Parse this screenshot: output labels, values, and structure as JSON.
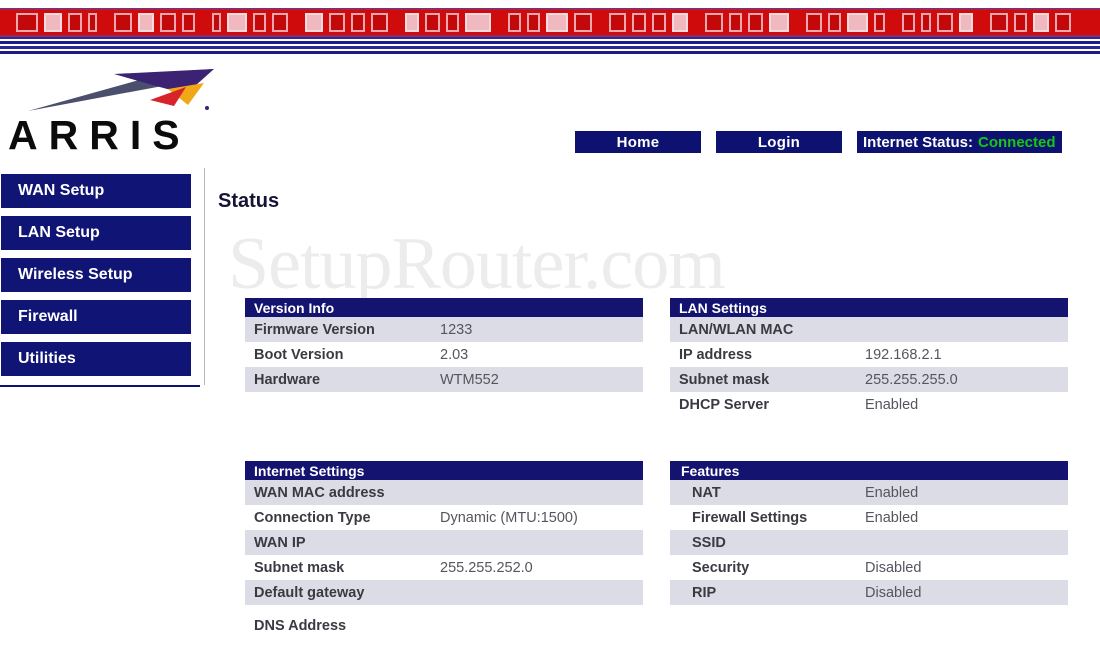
{
  "banner": {
    "name": "decorative-top-banner",
    "red": "#d00b0b",
    "accent_pale": "#f0b9c0",
    "line_navy": "#1b1b8c"
  },
  "brand": {
    "wordmark": "ARRIS",
    "swoosh_purple": "#3b2273",
    "swoosh_orange": "#f0a818",
    "swoosh_red": "#d8232a"
  },
  "topnav": {
    "buttons": [
      {
        "label": "Home",
        "name": "home-button"
      },
      {
        "label": "Login",
        "name": "login-button"
      }
    ],
    "status_label": "Internet Status:",
    "status_value": "Connected",
    "status_color": "#14c814"
  },
  "sidebar": {
    "items": [
      {
        "label": "WAN Setup"
      },
      {
        "label": "LAN Setup"
      },
      {
        "label": "Wireless Setup"
      },
      {
        "label": "Firewall"
      },
      {
        "label": "Utilities"
      }
    ]
  },
  "main": {
    "title": "Status",
    "watermark": "SetupRouter.com"
  },
  "panels": {
    "version_info": {
      "title": "Version Info",
      "rows": [
        {
          "key": "Firmware Version",
          "value": "1233"
        },
        {
          "key": "Boot Version",
          "value": "2.03"
        },
        {
          "key": "Hardware",
          "value": "WTM552"
        }
      ]
    },
    "lan_settings": {
      "title": "LAN Settings",
      "rows": [
        {
          "key": "LAN/WLAN MAC",
          "value": ""
        },
        {
          "key": "IP address",
          "value": "192.168.2.1"
        },
        {
          "key": "Subnet mask",
          "value": "255.255.255.0"
        },
        {
          "key": "DHCP Server",
          "value": "Enabled"
        }
      ]
    },
    "internet_settings": {
      "title": "Internet Settings",
      "rows": [
        {
          "key": "WAN MAC address",
          "value": ""
        },
        {
          "key": "Connection Type",
          "value": "Dynamic (MTU:1500)"
        },
        {
          "key": "WAN IP",
          "value": ""
        },
        {
          "key": "Subnet mask",
          "value": "255.255.252.0"
        },
        {
          "key": "Default gateway",
          "value": ""
        }
      ],
      "trailing_row": {
        "key": "DNS Address",
        "value": ""
      }
    },
    "features": {
      "title": "Features",
      "rows": [
        {
          "key": "NAT",
          "value": "Enabled"
        },
        {
          "key": "Firewall Settings",
          "value": "Enabled"
        },
        {
          "key": "SSID",
          "value": ""
        },
        {
          "key": "Security",
          "value": "Disabled"
        },
        {
          "key": "RIP",
          "value": "Disabled"
        }
      ]
    }
  }
}
